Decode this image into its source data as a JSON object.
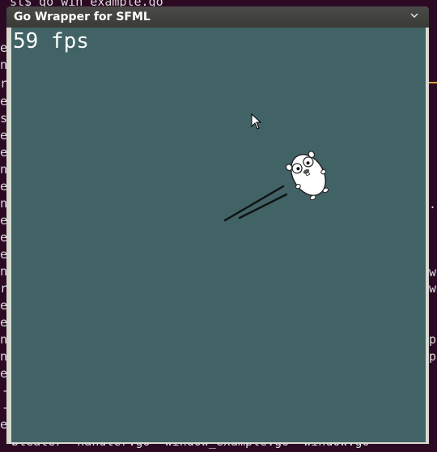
{
  "terminal": {
    "top_line": "st$ go win example.go",
    "bottom_line": "bleater  handler.go  window_example.go  window.go",
    "left_fragments": [
      "es",
      "n",
      "r",
      "es",
      "ss",
      "es",
      "es",
      "nc",
      "es",
      "nk",
      "es",
      "es",
      "es",
      "nk",
      "r",
      "es",
      "es",
      "nk",
      "nk",
      "es",
      "-",
      "-",
      "es",
      "es"
    ],
    "right_fragments": [
      ".",
      "w",
      "w",
      "p",
      "p"
    ]
  },
  "window": {
    "title": "Go Wrapper for SFML",
    "menu_icon": "chevron-down-icon",
    "canvas_color": "#416365",
    "fps_text": "59 fps"
  },
  "colors": {
    "terminal_bg": "#2c0a24",
    "titlebar": "#3c3c3a",
    "accent": "#d9a13a"
  }
}
